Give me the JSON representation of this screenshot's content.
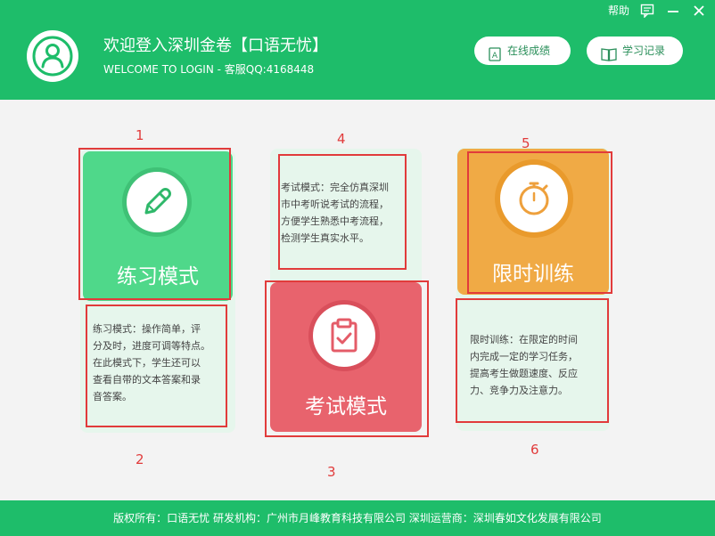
{
  "window": {
    "help_label": "帮助"
  },
  "header": {
    "title": "欢迎登入深圳金卷【口语无忧】",
    "subtitle": "WELCOME TO LOGIN - 客服QQ:4168448",
    "online_scores_label": "在线成绩",
    "study_records_label": "学习记录"
  },
  "modes": {
    "practice": {
      "label": "练习模式",
      "description": "练习模式：操作简单，评\n分及时，进度可调等特点。\n在此模式下，学生还可以\n查看自带的文本答案和录\n音答案。",
      "color": "#4fd88a"
    },
    "exam": {
      "label": "考试模式",
      "description": "考试模式：完全仿真深圳\n市中考听说考试的流程，\n方便学生熟悉中考流程，\n检测学生真实水平。",
      "color": "#e8636d"
    },
    "timed": {
      "label": "限时训练",
      "description": "限时训练：在限定的时间\n内完成一定的学习任务，\n提高考生做题速度、反应\n力、竞争力及注意力。",
      "color": "#f0aa45"
    }
  },
  "annotations": [
    "1",
    "2",
    "3",
    "4",
    "5",
    "6"
  ],
  "footer": {
    "text": "版权所有：口语无忧  研发机构：广州市月峰教育科技有限公司    深圳运营商：深圳春如文化发展有限公司"
  },
  "colors": {
    "brand_green": "#1ebd6a",
    "card_bg": "#e6f6ec",
    "annotation_red": "#e13b3b"
  },
  "icons": [
    "user-icon",
    "feedback-icon",
    "minimize-icon",
    "close-icon",
    "scores-icon",
    "book-icon",
    "pencil-icon",
    "clipboard-check-icon",
    "stopwatch-icon"
  ]
}
